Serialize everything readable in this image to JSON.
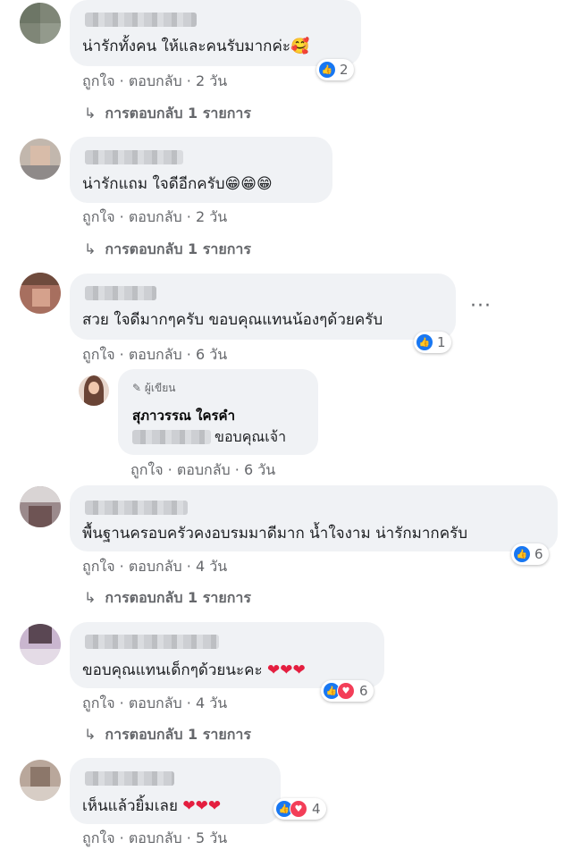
{
  "comments": [
    {
      "text": "น่ารักทั้งคน ให้และคนรับมากค่ะ🥰",
      "time": "2 วัน",
      "reactions": "2",
      "replies": "การตอบกลับ 1 รายการ"
    },
    {
      "text": "น่ารักแถม ใจดีอีกครับ😁😁😁",
      "time": "2 วัน",
      "replies": "การตอบกลับ 1 รายการ"
    },
    {
      "text": "สวย ใจดีมากๆครับ ขอบคุณแทนน้องๆด้วยครับ",
      "time": "6 วัน",
      "reactions": "1"
    },
    {
      "text": "พื้นฐานครอบครัวคงอบรมมาดีมาก น้ำใจงาม น่ารักมากครับ",
      "time": "4 วัน",
      "reactions": "6",
      "replies": "การตอบกลับ 1 รายการ"
    },
    {
      "text": "ขอบคุณแทนเด็กๆด้วยนะคะ",
      "hearts": "❤❤❤",
      "time": "4 วัน",
      "reactions": "6",
      "replies": "การตอบกลับ 1 รายการ"
    },
    {
      "text": "เห็นแล้วยิ้มเลย",
      "hearts": "❤❤❤",
      "time": "5 วัน",
      "reactions": "4"
    }
  ],
  "author_reply": {
    "badge": "ผู้เขียน",
    "name": "สุภาวรรณ ใครคำ",
    "text": "ขอบคุณเจ้า",
    "time": "6 วัน"
  },
  "actions": {
    "like": "ถูกใจ",
    "reply": "ตอบกลับ",
    "sep": "·"
  },
  "more": "···",
  "icons": {
    "like": "like-icon",
    "love": "love-icon",
    "reply_arrow": "reply-arrow-icon",
    "pencil": "pencil-icon"
  }
}
